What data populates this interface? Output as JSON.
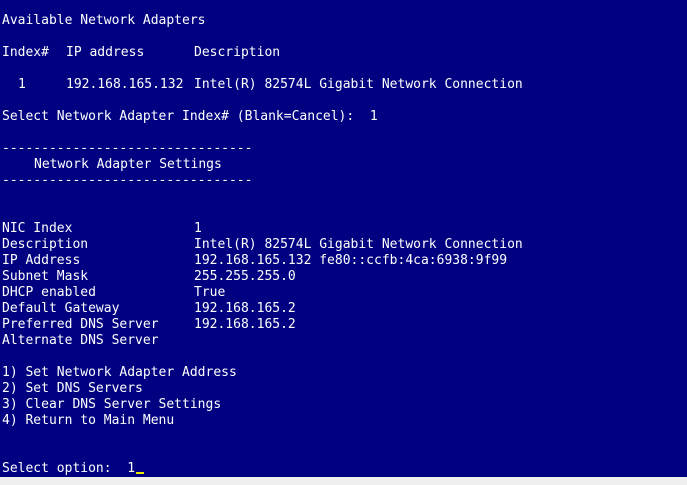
{
  "colors": {
    "background": "#000080",
    "text": "#ffffff",
    "cursor": "#e8e800"
  },
  "header": {
    "title": "Available Network Adapters",
    "columns": {
      "index": "Index#",
      "ip": "IP address",
      "description": "Description"
    },
    "rows": [
      {
        "index": "1",
        "ip": "192.168.165.132",
        "description": "Intel(R) 82574L Gigabit Network Connection"
      }
    ],
    "prompt": "Select Network Adapter Index# (Blank=Cancel):",
    "prompt_value": "1"
  },
  "settings": {
    "divider": "--------------------------------",
    "title": "Network Adapter Settings",
    "fields": [
      {
        "label": "NIC Index",
        "value": "1"
      },
      {
        "label": "Description",
        "value": "Intel(R) 82574L Gigabit Network Connection"
      },
      {
        "label": "IP Address",
        "value": "192.168.165.132 fe80::ccfb:4ca:6938:9f99"
      },
      {
        "label": "Subnet Mask",
        "value": "255.255.255.0"
      },
      {
        "label": "DHCP enabled",
        "value": "True"
      },
      {
        "label": "Default Gateway",
        "value": "192.168.165.2"
      },
      {
        "label": "Preferred DNS Server",
        "value": "192.168.165.2"
      },
      {
        "label": "Alternate DNS Server",
        "value": ""
      }
    ]
  },
  "menu": {
    "options": [
      "1) Set Network Adapter Address",
      "2) Set DNS Servers",
      "3) Clear DNS Server Settings",
      "4) Return to Main Menu"
    ],
    "prompt": "Select option:",
    "prompt_value": "1"
  }
}
